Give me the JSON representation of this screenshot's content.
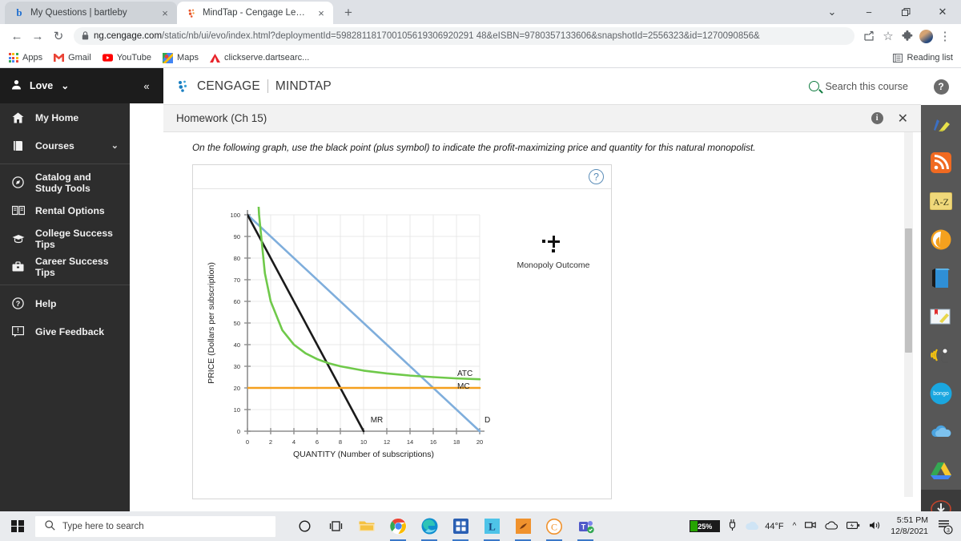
{
  "browser": {
    "tabs": [
      {
        "title": "My Questions | bartleby",
        "favicon": "b",
        "favicon_color": "#1f6fd0",
        "active": false
      },
      {
        "title": "MindTap - Cengage Learning",
        "favicon": "cengage-dots",
        "favicon_color": "#e8562c",
        "active": true
      }
    ],
    "new_tab_label": "+",
    "close_label": "×",
    "window_controls": {
      "dropdown": "⌄",
      "minimize": "−",
      "maximize": "❐",
      "close": "✕"
    },
    "nav": {
      "back": "←",
      "forward": "→",
      "reload": "↻"
    },
    "url_host": "ng.cengage.com",
    "url_path": "/static/nb/ui/evo/index.html?deploymentId=598281181700105619306920291 48&eISBN=9780357133606&snapshotId=2556323&id=1270090856&",
    "lock_icon": "🔒",
    "toolbar_icons": {
      "share": "⤴",
      "bookmark": "☆",
      "extensions": "❖",
      "menu": "⋮"
    },
    "bookmarks": [
      {
        "label": "Apps",
        "icon": "apps-grid"
      },
      {
        "label": "Gmail",
        "icon": "gmail-m"
      },
      {
        "label": "YouTube",
        "icon": "youtube-play"
      },
      {
        "label": "Maps",
        "icon": "maps-pin"
      },
      {
        "label": "clickserve.dartsearc...",
        "icon": "adobe-a"
      }
    ],
    "reading_list": "Reading list"
  },
  "sidebar": {
    "user": {
      "name": "Love",
      "chevron": "⌄"
    },
    "collapse_icon": "«",
    "items": [
      {
        "label": "My Home",
        "icon": "home-icon",
        "chevron": ""
      },
      {
        "label": "Courses",
        "icon": "book-icon",
        "chevron": "⌄"
      },
      {
        "label": "Catalog and Study Tools",
        "icon": "compass-icon",
        "chevron": ""
      },
      {
        "label": "Rental Options",
        "icon": "open-book-icon",
        "chevron": ""
      },
      {
        "label": "College Success Tips",
        "icon": "graduation-cap-icon",
        "chevron": ""
      },
      {
        "label": "Career Success Tips",
        "icon": "briefcase-icon",
        "chevron": ""
      },
      {
        "label": "Help",
        "icon": "question-circle-icon",
        "chevron": ""
      },
      {
        "label": "Give Feedback",
        "icon": "feedback-icon",
        "chevron": ""
      }
    ]
  },
  "app_header": {
    "brand": "CENGAGE",
    "product": "MINDTAP",
    "search_label": "Search this course",
    "help_icon": "?"
  },
  "activity": {
    "title": "Homework (Ch 15)",
    "info_icon": "i",
    "close_icon": "✕",
    "prompt": "On the following graph, use the black point (plus symbol) to indicate the profit-maximizing price and quantity for this natural monopolist.",
    "graph_help_icon": "?"
  },
  "legend": {
    "marker": "black-plus-point",
    "label": "Monopoly Outcome"
  },
  "chart_data": {
    "type": "line",
    "title": "",
    "xlabel": "QUANTITY (Number of subscriptions)",
    "ylabel": "PRICE (Dollars per subscription)",
    "xlim": [
      0,
      20
    ],
    "ylim": [
      0,
      100
    ],
    "xticks": [
      0,
      2,
      4,
      6,
      8,
      10,
      12,
      14,
      16,
      18,
      20
    ],
    "yticks": [
      0,
      10,
      20,
      30,
      40,
      50,
      60,
      70,
      80,
      90,
      100
    ],
    "grid": true,
    "legend_position": "inline-end-labels",
    "series": [
      {
        "name": "D",
        "label": "D",
        "color": "#7FAEDC",
        "kind": "demand",
        "x": [
          0,
          20
        ],
        "values": [
          100,
          0
        ]
      },
      {
        "name": "MR",
        "label": "MR",
        "color": "#1a1a1a",
        "kind": "marginal-revenue",
        "x": [
          0,
          10
        ],
        "values": [
          100,
          0
        ]
      },
      {
        "name": "MC",
        "label": "MC",
        "color": "#F5A01E",
        "kind": "marginal-cost",
        "x": [
          0,
          20
        ],
        "values": [
          20,
          20
        ]
      },
      {
        "name": "ATC",
        "label": "ATC",
        "color": "#6FC94A",
        "kind": "average-total-cost",
        "x": [
          0.8,
          1,
          1.5,
          2,
          3,
          4,
          5,
          6,
          7,
          8,
          10,
          12,
          14,
          16,
          18,
          20
        ],
        "values": [
          120,
          100,
          73,
          60,
          46.7,
          40,
          36,
          33.3,
          31.4,
          30,
          28,
          26.7,
          25.7,
          25,
          24.4,
          24
        ]
      }
    ],
    "annotations": [
      {
        "text": "Monopoly Outcome",
        "marker": "black plus symbol",
        "placed": false
      }
    ]
  },
  "scrollbar": {
    "up_arrow": "▲",
    "down_arrow": "▼"
  },
  "utility_rail": [
    {
      "icon": "highlighter-pen-icon",
      "name": "highlighter"
    },
    {
      "icon": "rss-feed-icon",
      "name": "rss"
    },
    {
      "icon": "a-z-dictionary-icon",
      "name": "dictionary",
      "label": "A-Z"
    },
    {
      "icon": "orange-swirl-icon",
      "name": "brand-tool"
    },
    {
      "icon": "blue-book-icon",
      "name": "ebook"
    },
    {
      "icon": "notes-pencil-icon",
      "name": "notes"
    },
    {
      "icon": "read-aloud-icon",
      "name": "read-aloud"
    },
    {
      "icon": "bongo-icon",
      "name": "bongo",
      "label": "bongo"
    },
    {
      "icon": "onedrive-cloud-icon",
      "name": "onedrive"
    },
    {
      "icon": "google-drive-icon",
      "name": "google-drive"
    },
    {
      "icon": "download-icon",
      "name": "download"
    }
  ],
  "taskbar": {
    "search_placeholder": "Type here to search",
    "apps": [
      {
        "name": "cortana",
        "icon": "circle-o"
      },
      {
        "name": "task-view",
        "icon": "task-view"
      },
      {
        "name": "file-explorer",
        "icon": "folder"
      },
      {
        "name": "chrome",
        "icon": "chrome",
        "running": true
      },
      {
        "name": "edge",
        "icon": "edge",
        "running": true
      },
      {
        "name": "microsoft-store",
        "icon": "store",
        "running": true
      },
      {
        "name": "lockdown-browser",
        "icon": "L",
        "running": true
      },
      {
        "name": "orange-app",
        "icon": "orange-app",
        "running": true
      },
      {
        "name": "cengage-app",
        "icon": "cengage-c",
        "running": true
      },
      {
        "name": "teams",
        "icon": "teams",
        "running": true
      }
    ],
    "battery_percent": "25%",
    "weather": "44°F",
    "time": "5:51 PM",
    "date": "12/8/2021",
    "notification_count": "3",
    "tray_icons": [
      "chevron-up",
      "camera",
      "cloud",
      "battery-charging",
      "volume"
    ]
  }
}
